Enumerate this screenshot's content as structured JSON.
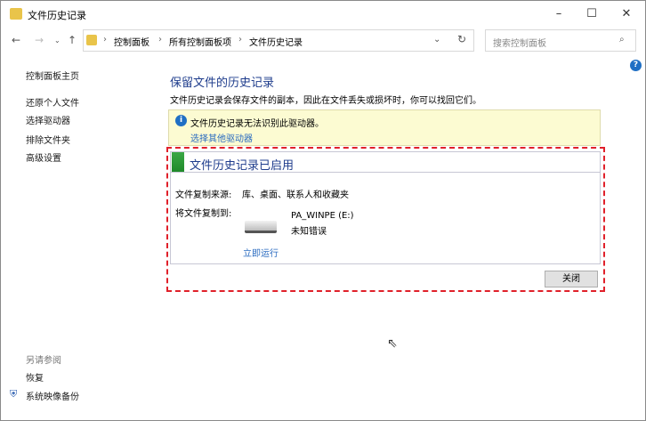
{
  "window": {
    "title": "文件历史记录",
    "minimize": "–",
    "maximize": "☐",
    "close": "✕"
  },
  "address": {
    "crumbs": [
      "控制面板",
      "所有控制面板项",
      "文件历史记录"
    ],
    "search_placeholder": "搜索控制面板"
  },
  "sidebar": {
    "items": [
      "控制面板主页",
      "还原个人文件",
      "选择驱动器",
      "排除文件夹",
      "高级设置"
    ],
    "see_also": "另请参阅",
    "see_also_items": [
      "恢复",
      "系统映像备份"
    ]
  },
  "main": {
    "heading": "保留文件的历史记录",
    "description": "文件历史记录会保存文件的副本，因此在文件丢失或损坏时，你可以找回它们。",
    "notice": {
      "text": "文件历史记录无法识别此驱动器。",
      "link": "选择其他驱动器"
    },
    "panel": {
      "title": "文件历史记录已启用",
      "source_label": "文件复制来源:",
      "source_value": "库、桌面、联系人和收藏夹",
      "dest_label": "将文件复制到:",
      "drive_name": "PA_WINPE (E:)",
      "drive_status": "未知错误",
      "run_now": "立即运行"
    },
    "close_button": "关闭"
  },
  "colors": {
    "accent": "#1e3c8c",
    "link": "#2a6bc0",
    "highlight_border": "#e0202a",
    "notice_bg": "#fcfbd2"
  }
}
